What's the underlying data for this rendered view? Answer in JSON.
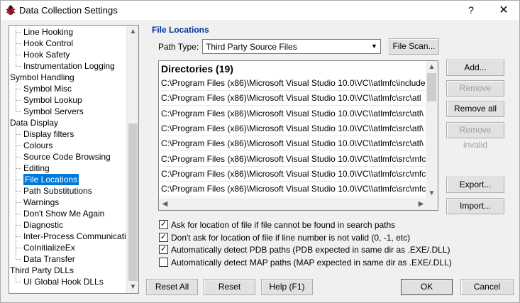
{
  "window": {
    "title": "Data Collection Settings",
    "help_glyph": "?",
    "close_glyph": "✕"
  },
  "tree": {
    "items": [
      {
        "label": "Line Hooking",
        "level": 1
      },
      {
        "label": "Hook Control",
        "level": 1
      },
      {
        "label": "Hook Safety",
        "level": 1
      },
      {
        "label": "Instrumentation Logging",
        "level": 1
      },
      {
        "label": "Symbol Handling",
        "level": 0
      },
      {
        "label": "Symbol Misc",
        "level": 1
      },
      {
        "label": "Symbol Lookup",
        "level": 1
      },
      {
        "label": "Symbol Servers",
        "level": 1
      },
      {
        "label": "Data Display",
        "level": 0
      },
      {
        "label": "Display filters",
        "level": 1
      },
      {
        "label": "Colours",
        "level": 1
      },
      {
        "label": "Source Code Browsing",
        "level": 1
      },
      {
        "label": "Editing",
        "level": 1
      },
      {
        "label": "File Locations",
        "level": 1,
        "selected": true
      },
      {
        "label": "Path Substitutions",
        "level": 1
      },
      {
        "label": "Warnings",
        "level": 1
      },
      {
        "label": "Don't Show Me Again",
        "level": 1
      },
      {
        "label": "Diagnostic",
        "level": 1
      },
      {
        "label": "Inter-Process Communication",
        "level": 1
      },
      {
        "label": "CoInitializeEx",
        "level": 1
      },
      {
        "label": "Data Transfer",
        "level": 1
      },
      {
        "label": "Third Party DLLs",
        "level": 0
      },
      {
        "label": "UI Global Hook DLLs",
        "level": 1
      }
    ]
  },
  "main": {
    "section_title": "File Locations",
    "path_type_label": "Path Type:",
    "path_type_value": "Third Party Source Files",
    "file_scan_label": "File Scan...",
    "list_header": "Directories (19)",
    "directories": [
      "C:\\Program Files (x86)\\Microsoft Visual Studio 10.0\\VC\\\\atlmfc\\include",
      "C:\\Program Files (x86)\\Microsoft Visual Studio 10.0\\VC\\\\atlmfc\\src\\atl",
      "C:\\Program Files (x86)\\Microsoft Visual Studio 10.0\\VC\\\\atlmfc\\src\\atl\\",
      "C:\\Program Files (x86)\\Microsoft Visual Studio 10.0\\VC\\\\atlmfc\\src\\atl\\",
      "C:\\Program Files (x86)\\Microsoft Visual Studio 10.0\\VC\\\\atlmfc\\src\\atl\\",
      "C:\\Program Files (x86)\\Microsoft Visual Studio 10.0\\VC\\\\atlmfc\\src\\mfc",
      "C:\\Program Files (x86)\\Microsoft Visual Studio 10.0\\VC\\\\atlmfc\\src\\mfc",
      "C:\\Program Files (x86)\\Microsoft Visual Studio 10.0\\VC\\\\atlmfc\\src\\mfc"
    ],
    "buttons": {
      "add": "Add...",
      "remove": "Remove",
      "remove_all": "Remove all",
      "remove_invalid": "Remove invalid",
      "export": "Export...",
      "import": "Import..."
    },
    "checkboxes": [
      {
        "label": "Ask for location of file if file cannot be found in search paths",
        "checked": true
      },
      {
        "label": "Don't ask for location of file if line number is not valid (0, -1, etc)",
        "checked": true
      },
      {
        "label": "Automatically detect PDB paths (PDB expected in same dir as .EXE/.DLL)",
        "checked": true
      },
      {
        "label": "Automatically detect MAP paths (MAP expected in same dir as .EXE/.DLL)",
        "checked": false
      }
    ]
  },
  "footer": {
    "reset_all": "Reset All",
    "reset": "Reset",
    "help": "Help (F1)",
    "ok": "OK",
    "cancel": "Cancel"
  },
  "colors": {
    "accent": "#003399",
    "selection": "#0078d7"
  }
}
